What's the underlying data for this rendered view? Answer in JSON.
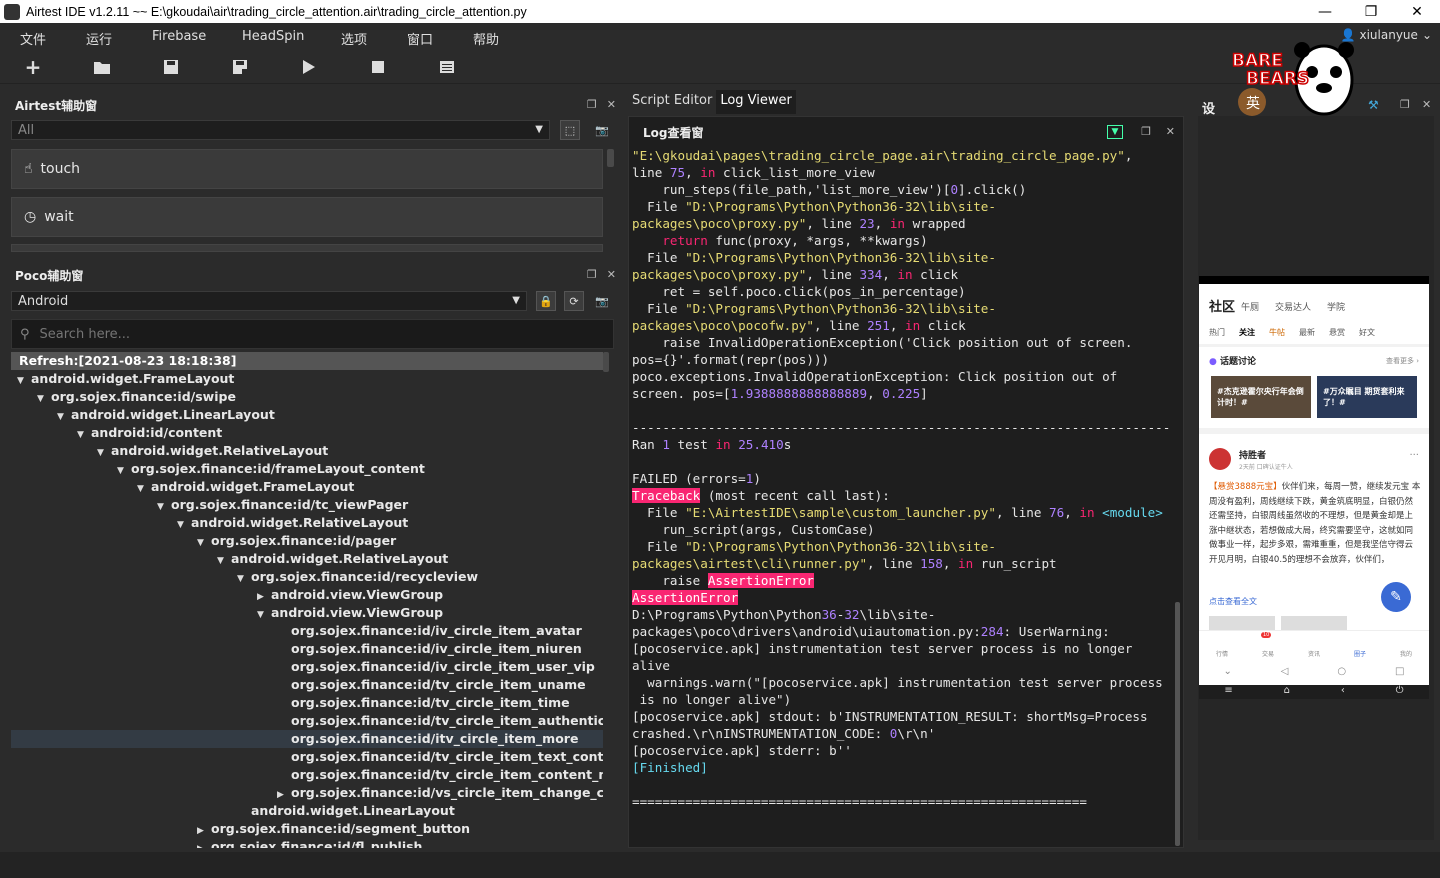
{
  "window": {
    "title": "Airtest IDE v1.2.11 ~~ E:\\gkoudai\\air\\trading_circle_attention.air\\trading_circle_attention.py",
    "min": "—",
    "max": "❐",
    "close": "✕"
  },
  "menu": [
    "文件",
    "运行",
    "Firebase",
    "HeadSpin",
    "选项",
    "窗口",
    "帮助"
  ],
  "user": {
    "name": "xiulanyue"
  },
  "airtest_panel": {
    "title": "Airtest辅助窗",
    "filter": "All",
    "commands": [
      "touch",
      "wait"
    ]
  },
  "poco_panel": {
    "title": "Poco辅助窗",
    "platform": "Android",
    "search_placeholder": "Search here...",
    "refresh": "Refresh:[2021-08-23 18:18:38]",
    "tree": [
      {
        "label": "android.widget.FrameLayout",
        "depth": 0,
        "state": "open"
      },
      {
        "label": "org.sojex.finance:id/swipe",
        "depth": 1,
        "state": "open"
      },
      {
        "label": "android.widget.LinearLayout",
        "depth": 2,
        "state": "open"
      },
      {
        "label": "android:id/content",
        "depth": 3,
        "state": "open"
      },
      {
        "label": "android.widget.RelativeLayout",
        "depth": 4,
        "state": "open"
      },
      {
        "label": "org.sojex.finance:id/frameLayout_content",
        "depth": 5,
        "state": "open"
      },
      {
        "label": "android.widget.FrameLayout",
        "depth": 6,
        "state": "open"
      },
      {
        "label": "org.sojex.finance:id/tc_viewPager",
        "depth": 7,
        "state": "open"
      },
      {
        "label": "android.widget.RelativeLayout",
        "depth": 8,
        "state": "open"
      },
      {
        "label": "org.sojex.finance:id/pager",
        "depth": 9,
        "state": "open"
      },
      {
        "label": "android.widget.RelativeLayout",
        "depth": 10,
        "state": "open"
      },
      {
        "label": "org.sojex.finance:id/recycleview",
        "depth": 11,
        "state": "open"
      },
      {
        "label": "android.view.ViewGroup",
        "depth": 12,
        "state": "closed"
      },
      {
        "label": "android.view.ViewGroup",
        "depth": 12,
        "state": "open"
      },
      {
        "label": "org.sojex.finance:id/iv_circle_item_avatar",
        "depth": 13,
        "state": "leaf"
      },
      {
        "label": "org.sojex.finance:id/iv_circle_item_niuren",
        "depth": 13,
        "state": "leaf"
      },
      {
        "label": "org.sojex.finance:id/iv_circle_item_user_vip",
        "depth": 13,
        "state": "leaf"
      },
      {
        "label": "org.sojex.finance:id/tv_circle_item_uname",
        "depth": 13,
        "state": "leaf"
      },
      {
        "label": "org.sojex.finance:id/tv_circle_item_time",
        "depth": 13,
        "state": "leaf"
      },
      {
        "label": "org.sojex.finance:id/tv_circle_item_authentication",
        "depth": 13,
        "state": "leaf"
      },
      {
        "label": "org.sojex.finance:id/itv_circle_item_more",
        "depth": 13,
        "state": "leaf",
        "selected": true
      },
      {
        "label": "org.sojex.finance:id/tv_circle_item_text_content",
        "depth": 13,
        "state": "leaf"
      },
      {
        "label": "org.sojex.finance:id/tv_circle_item_content_more",
        "depth": 13,
        "state": "leaf"
      },
      {
        "label": "org.sojex.finance:id/vs_circle_item_change_cont...",
        "depth": 13,
        "state": "closed"
      },
      {
        "label": "android.widget.LinearLayout",
        "depth": 11,
        "state": "leaf"
      },
      {
        "label": "org.sojex.finance:id/segment_button",
        "depth": 9,
        "state": "closed"
      },
      {
        "label": "org.sojex.finance:id/fl_publish",
        "depth": 9,
        "state": "closed"
      }
    ]
  },
  "editor": {
    "tabs": [
      "Script Editor",
      "Log Viewer"
    ],
    "active_tab": "Log Viewer",
    "log_title": "Log查看窗"
  },
  "log_lines": [
    [
      [
        "s",
        "\"E:\\gkoudai\\pages\\trading_circle_page.air\\trading_circle_page.py\""
      ],
      [
        "t",
        ","
      ]
    ],
    [
      [
        "t",
        "line "
      ],
      [
        "num",
        "75"
      ],
      [
        "t",
        ", "
      ],
      [
        "kw",
        "in"
      ],
      [
        "t",
        " click_list_more_view"
      ]
    ],
    [
      [
        "t",
        "    run_steps(file_path,'list_more_view')["
      ],
      [
        "num",
        "0"
      ],
      [
        "t",
        "].click()"
      ]
    ],
    [
      [
        "t",
        "  File "
      ],
      [
        "s",
        "\"D:\\Programs\\Python\\Python36-32\\lib\\site-"
      ]
    ],
    [
      [
        "s",
        "packages\\poco\\proxy.py\""
      ],
      [
        "t",
        ", line "
      ],
      [
        "num",
        "23"
      ],
      [
        "t",
        ", "
      ],
      [
        "kw",
        "in"
      ],
      [
        "t",
        " wrapped"
      ]
    ],
    [
      [
        "t",
        "    "
      ],
      [
        "kw",
        "return"
      ],
      [
        "t",
        " func(proxy, *args, **kwargs)"
      ]
    ],
    [
      [
        "t",
        "  File "
      ],
      [
        "s",
        "\"D:\\Programs\\Python\\Python36-32\\lib\\site-"
      ]
    ],
    [
      [
        "s",
        "packages\\poco\\proxy.py\""
      ],
      [
        "t",
        ", line "
      ],
      [
        "num",
        "334"
      ],
      [
        "t",
        ", "
      ],
      [
        "kw",
        "in"
      ],
      [
        "t",
        " click"
      ]
    ],
    [
      [
        "t",
        "    ret = self.poco.click(pos_in_percentage)"
      ]
    ],
    [
      [
        "t",
        "  File "
      ],
      [
        "s",
        "\"D:\\Programs\\Python\\Python36-32\\lib\\site-"
      ]
    ],
    [
      [
        "s",
        "packages\\poco\\pocofw.py\""
      ],
      [
        "t",
        ", line "
      ],
      [
        "num",
        "251"
      ],
      [
        "t",
        ", "
      ],
      [
        "kw",
        "in"
      ],
      [
        "t",
        " click"
      ]
    ],
    [
      [
        "t",
        "    raise InvalidOperationException('Click position out of screen."
      ]
    ],
    [
      [
        "t",
        "pos={}'.format(repr(pos)))"
      ]
    ],
    [
      [
        "t",
        "poco.exceptions.InvalidOperationException: Click position out of"
      ]
    ],
    [
      [
        "t",
        "screen. pos=["
      ],
      [
        "num",
        "1.9388888888888889"
      ],
      [
        "t",
        ", "
      ],
      [
        "num",
        "0.225"
      ],
      [
        "t",
        "]"
      ]
    ],
    [
      [
        "t",
        ""
      ]
    ],
    [
      [
        "t",
        "-----------------------------------------------------------------------"
      ]
    ],
    [
      [
        "t",
        "Ran "
      ],
      [
        "num",
        "1"
      ],
      [
        "t",
        " test "
      ],
      [
        "kw",
        "in"
      ],
      [
        "t",
        " "
      ],
      [
        "num",
        "25.410"
      ],
      [
        "t",
        "s"
      ]
    ],
    [
      [
        "t",
        ""
      ]
    ],
    [
      [
        "t",
        "FAILED (errors="
      ],
      [
        "num",
        "1"
      ],
      [
        "t",
        ")"
      ]
    ],
    [
      [
        "hl",
        "Traceback"
      ],
      [
        "t",
        " (most recent call last):"
      ]
    ],
    [
      [
        "t",
        "  File "
      ],
      [
        "s",
        "\"E:\\AirtestIDE\\sample\\custom_launcher.py\""
      ],
      [
        "t",
        ", line "
      ],
      [
        "num",
        "76"
      ],
      [
        "t",
        ", "
      ],
      [
        "kw",
        "in"
      ],
      [
        "t",
        " "
      ],
      [
        "fin",
        "<module>"
      ]
    ],
    [
      [
        "t",
        "    run_script(args, CustomCase)"
      ]
    ],
    [
      [
        "t",
        "  File "
      ],
      [
        "s",
        "\"D:\\Programs\\Python\\Python36-32\\lib\\site-"
      ]
    ],
    [
      [
        "s",
        "packages\\airtest\\cli\\runner.py\""
      ],
      [
        "t",
        ", line "
      ],
      [
        "num",
        "158"
      ],
      [
        "t",
        ", "
      ],
      [
        "kw",
        "in"
      ],
      [
        "t",
        " run_script"
      ]
    ],
    [
      [
        "t",
        "    raise "
      ],
      [
        "hl",
        "AssertionError"
      ]
    ],
    [
      [
        "hl",
        "AssertionError"
      ]
    ],
    [
      [
        "t",
        "D:\\Programs\\Python\\Python"
      ],
      [
        "num",
        "36"
      ],
      [
        "t",
        "-"
      ],
      [
        "num",
        "32"
      ],
      [
        "t",
        "\\lib\\site-"
      ]
    ],
    [
      [
        "t",
        "packages\\poco\\drivers\\android\\uiautomation.py:"
      ],
      [
        "num",
        "284"
      ],
      [
        "t",
        ": UserWarning:"
      ]
    ],
    [
      [
        "t",
        "[pocoservice.apk] instrumentation test server process is no longer"
      ]
    ],
    [
      [
        "t",
        "alive"
      ]
    ],
    [
      [
        "t",
        "  warnings.warn(\"[pocoservice.apk] instrumentation test server process"
      ]
    ],
    [
      [
        "t",
        " is no longer alive\")"
      ]
    ],
    [
      [
        "t",
        "[pocoservice.apk] stdout: b'INSTRUMENTATION_RESULT: shortMsg=Process"
      ]
    ],
    [
      [
        "t",
        "crashed.\\r\\nINSTRUMENTATION_CODE: "
      ],
      [
        "num",
        "0"
      ],
      [
        "t",
        "\\r\\n'"
      ]
    ],
    [
      [
        "t",
        "[pocoservice.apk] stderr: b''"
      ]
    ],
    [
      [
        "fin",
        "[Finished]"
      ]
    ],
    [
      [
        "t",
        ""
      ]
    ],
    [
      [
        "t",
        "============================================================"
      ]
    ]
  ],
  "device": {
    "header": {
      "title": "社区",
      "tabs": [
        "午厕",
        "交易达人",
        "学院"
      ]
    },
    "subtabs": [
      "热门",
      "关注",
      "牛帖",
      "最新",
      "悬赏",
      "好文"
    ],
    "topic_title": "话题讨论",
    "topic_more": "查看更多 ›",
    "cards": [
      "#杰克逊霍尔央行年会倒计时！#",
      "#万众瞩目 期货套利来了！#"
    ],
    "post_user": "持胜者",
    "post_meta": "2天前  口碑认证牛人",
    "post_badge": "【悬赏3888元宝】",
    "post_text": "伙伴们来，每周一赞，继续发元宝 本周没有盈利，周线继续下跌，黄金筑底明显，白银仍然还需坚持，白银周线虽然收的不理想，但是黄金却是上涨中继状态，若想做成大局，终究需要坚守，这就如同做事业一样，起步多艰，需难重重，但是我坚信守得云开见月明，白银40.5的理想不会放弃，伙伴们，",
    "post_more": "点击查看全文",
    "bottom_nav": [
      "行情",
      "交易",
      "资讯",
      "圈子",
      "我的"
    ],
    "badge_count": "10"
  },
  "colors": {
    "bg": "#2b2b2b",
    "log_bg": "#1e1e1e",
    "string": "#e6db74",
    "keyword": "#f92672",
    "number": "#ae81ff",
    "finished": "#66d9ef"
  }
}
